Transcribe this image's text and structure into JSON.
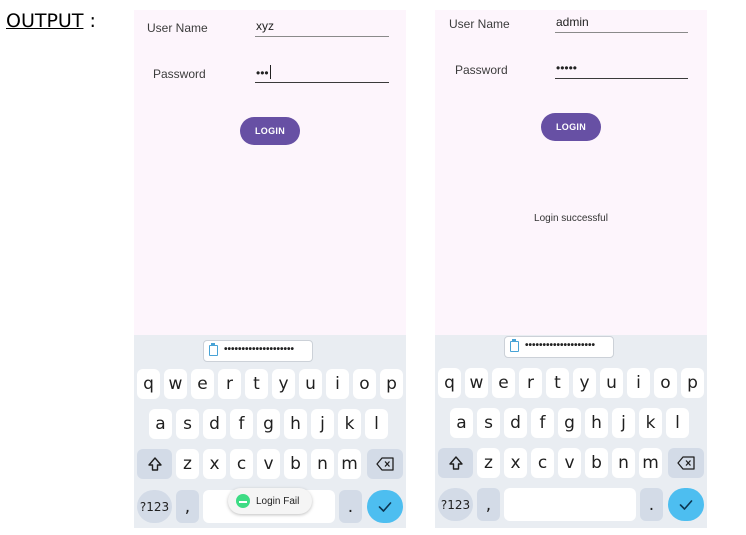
{
  "output_label": "OUTPUT",
  "output_colon": " :",
  "left": {
    "username_label": "User Name",
    "username_value": "xyz",
    "password_label": "Password",
    "password_value": "•••",
    "login_button": "LOGIN",
    "clipboard_text": "••••••••••••••••••••",
    "toast_text": "Login Fail"
  },
  "right": {
    "username_label": "User Name",
    "username_value": "admin",
    "password_label": "Password",
    "password_value": "•••••",
    "login_button": "LOGIN",
    "status_text": "Login successful",
    "clipboard_text": "••••••••••••••••••••"
  },
  "keyboard": {
    "row1": [
      "q",
      "w",
      "e",
      "r",
      "t",
      "y",
      "u",
      "i",
      "o",
      "p"
    ],
    "row2": [
      "a",
      "s",
      "d",
      "f",
      "g",
      "h",
      "j",
      "k",
      "l"
    ],
    "row3": [
      "z",
      "x",
      "c",
      "v",
      "b",
      "n",
      "m"
    ],
    "symbols_key": "?123",
    "comma_key": ",",
    "period_key": ".",
    "shift_icon": "shift-icon",
    "backspace_icon": "backspace-icon",
    "enter_icon": "checkmark-icon"
  },
  "colors": {
    "button": "#6750a4",
    "app_background": "#fdf5fc",
    "keyboard_background": "#e9edf2",
    "enter_key": "#4dbef0"
  }
}
